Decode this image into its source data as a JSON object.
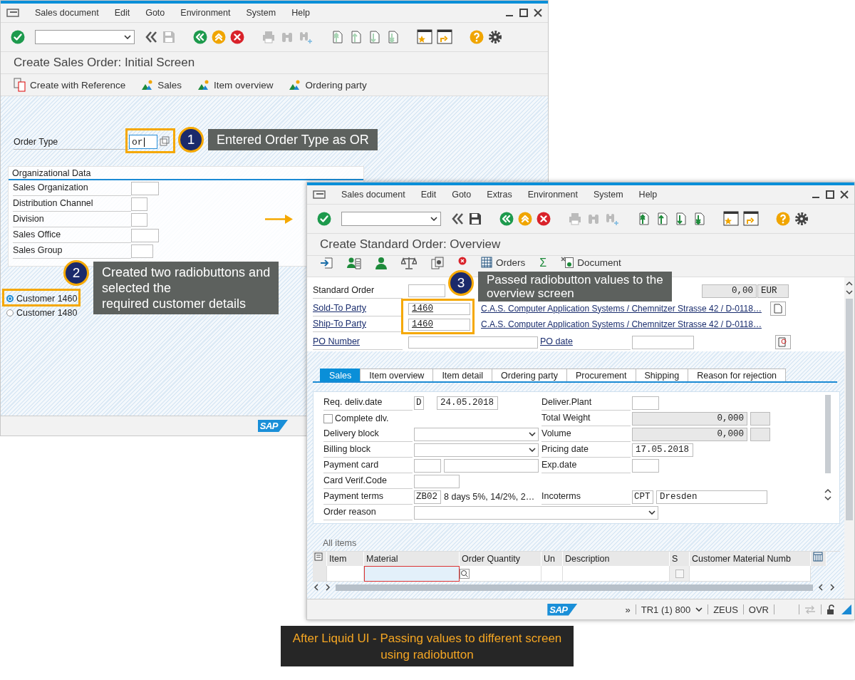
{
  "initial_window": {
    "menu": [
      "Sales document",
      "Edit",
      "Goto",
      "Environment",
      "System",
      "Help"
    ],
    "toolbar": {
      "save_enabled": false,
      "paging_enabled": false
    },
    "title": "Create Sales Order: Initial Screen",
    "app_toolbar": [
      {
        "label": "Create with Reference",
        "kind": "reference"
      },
      {
        "label": "Sales",
        "kind": "overview"
      },
      {
        "label": "Item overview",
        "kind": "overview"
      },
      {
        "label": "Ordering party",
        "kind": "overview"
      }
    ],
    "order_type": {
      "label": "Order Type",
      "value": "or"
    },
    "org_data": {
      "title": "Organizational Data",
      "fields": [
        "Sales Organization",
        "Distribution Channel",
        "Division",
        "Sales Office",
        "Sales Group"
      ]
    },
    "radios": [
      {
        "label": "Customer 1460",
        "selected": true
      },
      {
        "label": "Customer 1480",
        "selected": false
      }
    ],
    "logo": "SAP"
  },
  "overview_window": {
    "menu": [
      "Sales document",
      "Edit",
      "Goto",
      "Extras",
      "Environment",
      "System",
      "Help"
    ],
    "toolbar": {
      "save_enabled": true,
      "paging_enabled": true
    },
    "title": "Create Standard Order: Overview",
    "app_toolbar": [
      {
        "label": "Orders",
        "kind": "grid"
      },
      {
        "label": "Σ",
        "kind": "glyph"
      },
      {
        "label": "Document",
        "kind": "document"
      }
    ],
    "header": {
      "order_label": "Standard Order",
      "net_value": "0,00",
      "currency": "EUR",
      "parties": [
        {
          "label": "Sold-To Party",
          "number": "1460",
          "name": "C.A.S. Computer Application Systems / Chemnitzer Strasse 42 / D-0118…",
          "doc_button": true
        },
        {
          "label": "Ship-To Party",
          "number": "1460",
          "name": "C.A.S. Computer Application Systems / Chemnitzer Strasse 42 / D-0118…",
          "doc_button": false
        }
      ],
      "po_number_label": "PO Number",
      "po_date_label": "PO date"
    },
    "tabs": [
      {
        "label": "Sales",
        "selected": true
      },
      {
        "label": "Item overview",
        "selected": false
      },
      {
        "label": "Item detail",
        "selected": false
      },
      {
        "label": "Ordering party",
        "selected": false
      },
      {
        "label": "Procurement",
        "selected": false
      },
      {
        "label": "Shipping",
        "selected": false
      },
      {
        "label": "Reason for rejection",
        "selected": false
      }
    ],
    "sales_rows": [
      {
        "left": {
          "label": "Req. deliv.date",
          "kind": "code_date",
          "code": "D",
          "value": "24.05.2018"
        },
        "right": {
          "label": "Deliver.Plant",
          "kind": "empty"
        }
      },
      {
        "left": {
          "label": "Complete dlv.",
          "kind": "checkbox",
          "checked": false
        },
        "right": {
          "label": "Total Weight",
          "kind": "readonly",
          "value": "0,000"
        }
      },
      {
        "left": {
          "label": "Delivery block",
          "kind": "dropdown"
        },
        "right": {
          "label": "Volume",
          "kind": "readonly",
          "value": "0,000"
        }
      },
      {
        "left": {
          "label": "Billing block",
          "kind": "dropdown"
        },
        "right": {
          "label": "Pricing date",
          "kind": "field",
          "value": "17.05.2018"
        }
      },
      {
        "left": {
          "label": "Payment card",
          "kind": "card"
        },
        "right": {
          "label": "Exp.date",
          "kind": "empty"
        }
      },
      {
        "left": {
          "label": "Card Verif.Code",
          "kind": "empty"
        }
      },
      {
        "left": {
          "label": "Payment terms",
          "kind": "code_text",
          "code": "ZB02",
          "value": "8 days 5%, 14/2%, 2…"
        },
        "right": {
          "label": "Incoterms",
          "kind": "code_field",
          "code": "CPT",
          "value": "Dresden"
        }
      },
      {
        "left": {
          "label": "Order reason",
          "kind": "wide_dropdown"
        }
      }
    ],
    "items": {
      "title": "All items",
      "columns": [
        "Item",
        "Material",
        "Order Quantity",
        "Un",
        "Description",
        "S",
        "Customer Material Numb"
      ]
    },
    "status": {
      "logo": "SAP",
      "expand": "»",
      "system": "TR1 (1) 800",
      "user": "ZEUS",
      "mode": "OVR"
    }
  },
  "callouts": [
    {
      "number": "1",
      "lines": [
        "Entered Order Type as OR"
      ]
    },
    {
      "number": "2",
      "lines": [
        "Created two radiobuttons and",
        "selected the",
        "required customer details"
      ]
    },
    {
      "number": "3",
      "lines": [
        "Passed radiobutton values to the",
        "overview screen"
      ]
    }
  ],
  "caption": "After Liquid UI - Passing values to different screen using radiobutton"
}
